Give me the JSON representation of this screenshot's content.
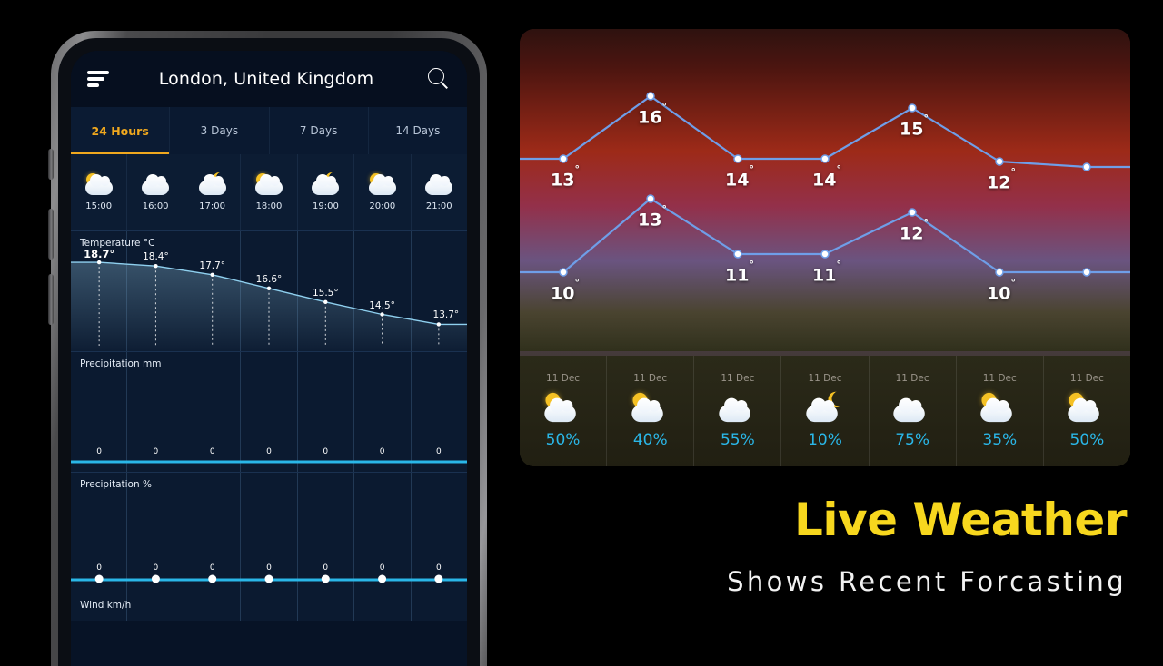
{
  "phone": {
    "header": {
      "title": "London, United Kingdom",
      "menu_icon": "hamburger-icon",
      "search_icon": "search-icon"
    },
    "tabs": [
      {
        "label": "24 Hours",
        "active": true
      },
      {
        "label": "3 Days",
        "active": false
      },
      {
        "label": "7 Days",
        "active": false
      },
      {
        "label": "14 Days",
        "active": false
      }
    ],
    "hourly": [
      {
        "time": "15:00",
        "icon": "sun-behind-cloud-icon"
      },
      {
        "time": "16:00",
        "icon": "cloud-icon"
      },
      {
        "time": "17:00",
        "icon": "moon-behind-cloud-icon"
      },
      {
        "time": "18:00",
        "icon": "sun-behind-cloud-icon"
      },
      {
        "time": "19:00",
        "icon": "moon-behind-cloud-icon"
      },
      {
        "time": "20:00",
        "icon": "sun-behind-cloud-icon"
      },
      {
        "time": "21:00",
        "icon": "cloud-icon"
      }
    ],
    "temperature_panel": {
      "label": "Temperature °C"
    },
    "precip_mm_panel": {
      "label": "Precipitation mm"
    },
    "precip_pct_panel": {
      "label": "Precipitation %"
    },
    "wind_panel": {
      "label": "Wind km/h"
    }
  },
  "right_panel": {
    "days": [
      {
        "date": "11 Dec",
        "icon": "sun-behind-cloud-icon",
        "pct": "50%"
      },
      {
        "date": "11 Dec",
        "icon": "sun-behind-cloud-icon",
        "pct": "40%"
      },
      {
        "date": "11 Dec",
        "icon": "cloud-icon",
        "pct": "55%"
      },
      {
        "date": "11 Dec",
        "icon": "moon-behind-cloud-icon",
        "pct": "10%"
      },
      {
        "date": "11 Dec",
        "icon": "cloud-icon",
        "pct": "75%"
      },
      {
        "date": "11 Dec",
        "icon": "sun-behind-cloud-icon",
        "pct": "35%"
      },
      {
        "date": "11 Dec",
        "icon": "sun-behind-cloud-icon",
        "pct": "50%"
      }
    ]
  },
  "promo": {
    "title": "Live Weather",
    "subtitle": "Shows Recent Forcasting"
  },
  "colors": {
    "accent_amber": "#f0a81e",
    "promo_yellow": "#f7d71e",
    "cyan": "#2ab7e8",
    "line_blue": "#6f9ee8",
    "chart_line_light": "#8fd0ef",
    "phone_screen_bg": "#0b1a30"
  },
  "chart_data": [
    {
      "type": "line",
      "title": "Temperature °C",
      "categories": [
        "15:00",
        "16:00",
        "17:00",
        "18:00",
        "19:00",
        "20:00",
        "21:00"
      ],
      "values": [
        18.7,
        18.4,
        17.7,
        16.6,
        15.5,
        14.5,
        13.7
      ],
      "labels": [
        "18.7°",
        "18.4°",
        "17.7°",
        "16.6°",
        "15.5°",
        "14.5°",
        "13.7°"
      ],
      "xlabel": "",
      "ylabel": "Temperature °C",
      "ylim": [
        13,
        19
      ],
      "grid": true,
      "legend": "none"
    },
    {
      "type": "line",
      "title": "Precipitation mm",
      "categories": [
        "15:00",
        "16:00",
        "17:00",
        "18:00",
        "19:00",
        "20:00",
        "21:00"
      ],
      "values": [
        0,
        0,
        0,
        0,
        0,
        0,
        0
      ],
      "labels": [
        "0",
        "0",
        "0",
        "0",
        "0",
        "0",
        "0"
      ],
      "xlabel": "",
      "ylabel": "Precipitation mm",
      "ylim": [
        0,
        1
      ],
      "grid": true,
      "legend": "none"
    },
    {
      "type": "line",
      "title": "Precipitation %",
      "categories": [
        "15:00",
        "16:00",
        "17:00",
        "18:00",
        "19:00",
        "20:00",
        "21:00"
      ],
      "values": [
        0,
        0,
        0,
        0,
        0,
        0,
        0
      ],
      "labels": [
        "0",
        "0",
        "0",
        "0",
        "0",
        "0",
        "0"
      ],
      "xlabel": "",
      "ylabel": "Precipitation %",
      "ylim": [
        0,
        100
      ],
      "grid": true,
      "legend": "none"
    },
    {
      "type": "line",
      "title": "",
      "categories": [
        "11 Dec",
        "11 Dec",
        "11 Dec",
        "11 Dec",
        "11 Dec",
        "11 Dec",
        "11 Dec"
      ],
      "series": [
        {
          "name": "high",
          "values": [
            13,
            16,
            14,
            14,
            15,
            12,
            12
          ],
          "labels": [
            "13°",
            "16°",
            "14°",
            "14°",
            "15°",
            "12°",
            ""
          ]
        },
        {
          "name": "low",
          "values": [
            10,
            13,
            11,
            11,
            12,
            10,
            10
          ],
          "labels": [
            "10°",
            "13°",
            "11°",
            "11°",
            "12°",
            "10°",
            ""
          ]
        }
      ],
      "xlabel": "",
      "ylabel": "",
      "ylim": [
        9,
        17
      ],
      "grid": false,
      "legend": "none"
    }
  ]
}
